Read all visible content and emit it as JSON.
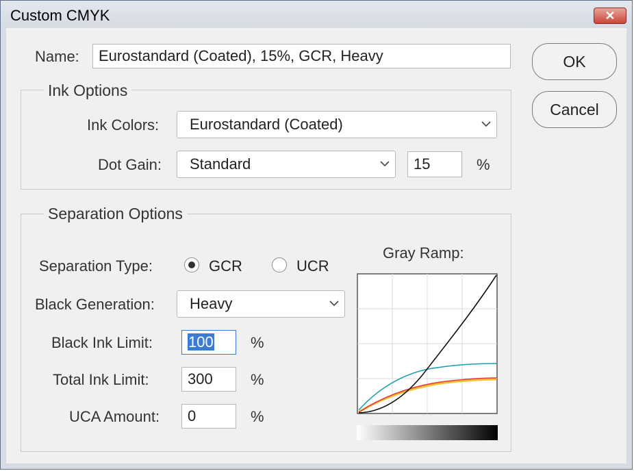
{
  "window": {
    "title": "Custom CMYK",
    "close_symbol": "✕"
  },
  "name_field": {
    "label": "Name:",
    "value": "Eurostandard (Coated), 15%, GCR, Heavy"
  },
  "buttons": {
    "ok": "OK",
    "cancel": "Cancel"
  },
  "ink_options": {
    "title": "Ink Options",
    "ink_colors": {
      "label": "Ink Colors:",
      "value": "Eurostandard (Coated)"
    },
    "dot_gain": {
      "label": "Dot Gain:",
      "value": "Standard",
      "amount": "15",
      "unit": "%"
    }
  },
  "separation_options": {
    "title": "Separation Options",
    "separation_type": {
      "label": "Separation Type:",
      "options": [
        "GCR",
        "UCR"
      ],
      "selected": "GCR"
    },
    "black_generation": {
      "label": "Black Generation:",
      "value": "Heavy"
    },
    "black_ink_limit": {
      "label": "Black Ink Limit:",
      "value": "100",
      "unit": "%"
    },
    "total_ink_limit": {
      "label": "Total Ink Limit:",
      "value": "300",
      "unit": "%"
    },
    "uca_amount": {
      "label": "UCA Amount:",
      "value": "0",
      "unit": "%"
    }
  },
  "gray_ramp": {
    "label": "Gray Ramp:",
    "curve_colors": {
      "black": "#111111",
      "cyan": "#1a9bb0",
      "magenta": "#e23a3a",
      "yellow": "#f0c030"
    }
  },
  "icons": {
    "dropdown": "chevron-down-icon",
    "close": "close-icon"
  }
}
